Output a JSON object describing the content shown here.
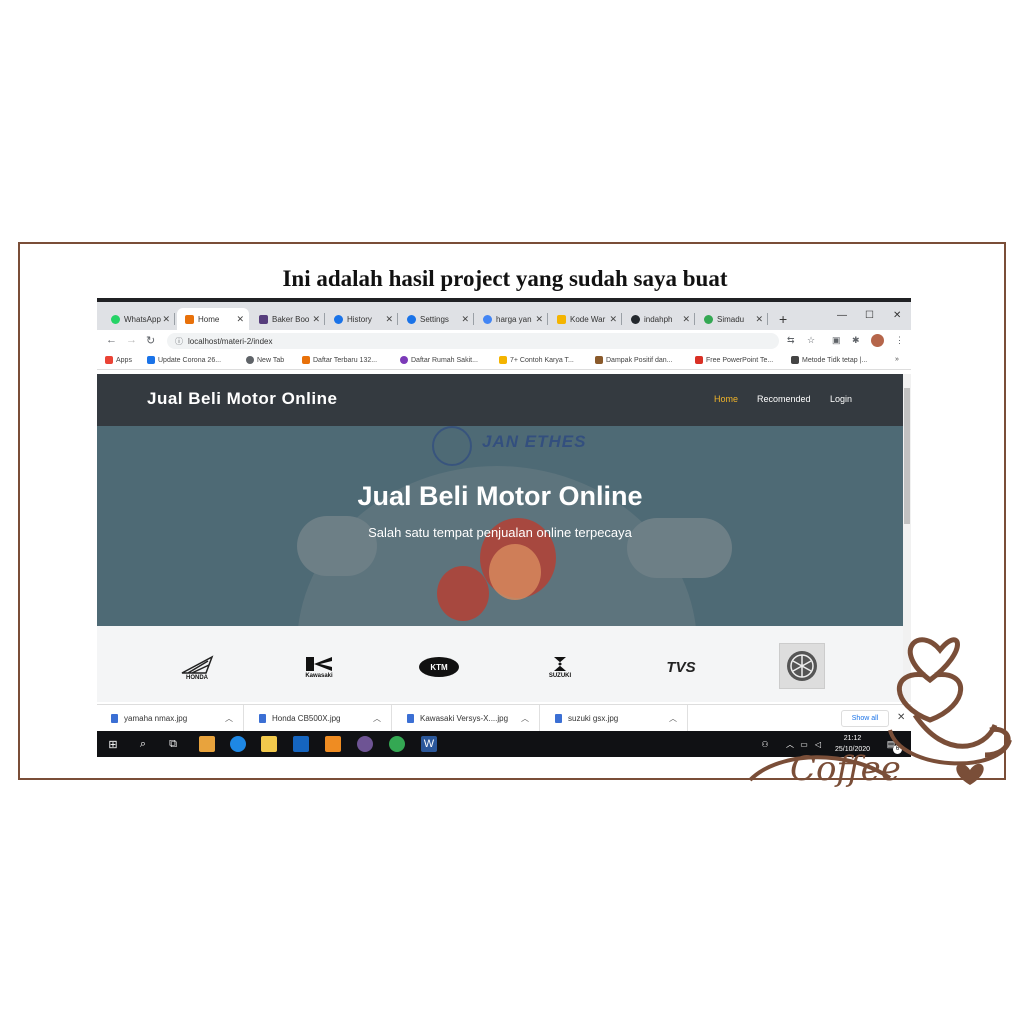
{
  "caption": "Ini adalah hasil project yang sudah saya buat",
  "browser": {
    "tabs": [
      {
        "label": "WhatsApp",
        "color": "#25d366"
      },
      {
        "label": "Home",
        "color": "#e8710a"
      },
      {
        "label": "Baker Boo",
        "color": "#563d7c"
      },
      {
        "label": "History",
        "color": "#1a73e8"
      },
      {
        "label": "Settings",
        "color": "#1a73e8"
      },
      {
        "label": "harga yan",
        "color": "#4285f4"
      },
      {
        "label": "Kode War",
        "color": "#f4b400"
      },
      {
        "label": "indahph",
        "color": "#24292e"
      },
      {
        "label": "Simadu",
        "color": "#34a853"
      }
    ],
    "new_tab": "+",
    "url": "localhost/materi-2/index",
    "bookmarks": [
      {
        "label": "Apps",
        "color": "#ea4335"
      },
      {
        "label": "Update Corona 26...",
        "color": "#1a73e8"
      },
      {
        "label": "New Tab",
        "color": "#5f6368"
      },
      {
        "label": "Daftar Terbaru 132...",
        "color": "#e8710a"
      },
      {
        "label": "Daftar Rumah Sakit...",
        "color": "#7b3ab8"
      },
      {
        "label": "7+ Contoh Karya T...",
        "color": "#f4b400"
      },
      {
        "label": "Dampak Positif dan...",
        "color": "#8a5a2b"
      },
      {
        "label": "Free PowerPoint Te...",
        "color": "#d93025"
      },
      {
        "label": "Metode Tidk tetap |...",
        "color": "#444"
      }
    ],
    "more_bookmarks": "»"
  },
  "site": {
    "brand": "Jual Beli Motor Online",
    "nav": {
      "home": "Home",
      "recommended": "Recomended",
      "login": "Login"
    },
    "watermark": "JAN ETHES",
    "hero_title": "Jual Beli Motor Online",
    "hero_subtitle": "Salah satu tempat penjualan online terpecaya",
    "brands": [
      "HONDA",
      "Kawasaki",
      "KTM",
      "SUZUKI",
      "TVS",
      "YAMAHA"
    ]
  },
  "downloads": {
    "items": [
      "yamaha nmax.jpg",
      "Honda CB500X.jpg",
      "Kawasaki Versys-X....jpg",
      "suzuki gsx.jpg"
    ],
    "show_all": "Show all"
  },
  "taskbar": {
    "time": "21:12",
    "date": "25/10/2020",
    "notification_count": "6"
  },
  "decoration": {
    "coffee_text": "Coffee",
    "accent_color": "#7a4e38"
  }
}
